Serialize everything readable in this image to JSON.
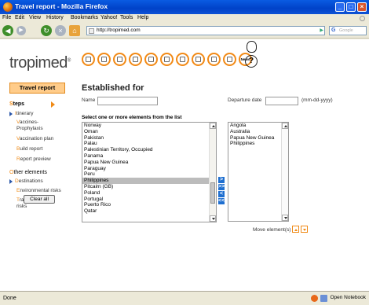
{
  "window": {
    "title": "Travel report - Mozilla Firefox"
  },
  "menu": [
    "File",
    "Edit",
    "View",
    "History",
    "Bookmarks",
    "Yahoo!",
    "Tools",
    "Help"
  ],
  "nav": {
    "url": "http://tropimed.com",
    "search_placeholder": "Google",
    "go_label": "▶",
    "search_engine": "G"
  },
  "logo": {
    "text": "tropimed"
  },
  "top_icons": [
    "compass-icon",
    "syringe-icon",
    "medicine-icon",
    "camera-icon",
    "mountain-icon",
    "first-aid-kit-icon",
    "bug-icon",
    "home-icon",
    "document-icon",
    "document-list-icon",
    "news-icon"
  ],
  "top_news_label": "News",
  "help": {
    "q": "?"
  },
  "sidebar": {
    "travel_report": "Travel report",
    "steps_label_s": "S",
    "steps_label": "teps",
    "steps": [
      {
        "first": "I",
        "rest": "tinerary"
      },
      {
        "first": "V",
        "rest": "accines-"
      },
      {
        "first": "",
        "rest": "Prophylaxis"
      },
      {
        "first": "V",
        "rest": "accination plan"
      },
      {
        "first": "B",
        "rest": "uild report"
      },
      {
        "first": "R",
        "rest": "eport preview"
      }
    ],
    "other_label_o": "O",
    "other_label": "ther elements",
    "other": [
      {
        "first": "D",
        "rest": "estinations"
      },
      {
        "first": "E",
        "rest": "nvironmental risks"
      },
      {
        "first": "T",
        "rest": "raveler-related"
      },
      {
        "first": "",
        "rest": "risks"
      }
    ],
    "clear_all": "Clear all"
  },
  "main": {
    "title": "Established for",
    "name_label": "Name",
    "name_value": "",
    "departure_label": "Departure date",
    "departure_value": "",
    "date_format": "(mm-dd-yyyy)",
    "select_label": "Select one or more elements from the list",
    "countries": [
      "Norway",
      "Oman",
      "Pakistan",
      "Palau",
      "Palestinian Territory, Occupied",
      "Panama",
      "Papua New Guinea",
      "Paraguay",
      "Peru",
      "Philippines",
      "Pitcairn (GB)",
      "Poland",
      "Portugal",
      "Puerto Rico",
      "Qatar"
    ],
    "selected_country": "Philippines",
    "chosen": [
      "Angola",
      "Australia",
      "Papua New Guinea",
      "Philippines"
    ],
    "move_buttons": [
      ">",
      ">>",
      "<",
      "<<"
    ],
    "move_label": "Move element(s)"
  },
  "status": {
    "text": "Done",
    "open_notebook": "Open Notebook"
  },
  "colors": {
    "accent": "#f08a16",
    "titlebar": "#0a5be2",
    "link": "#2a56a8"
  }
}
